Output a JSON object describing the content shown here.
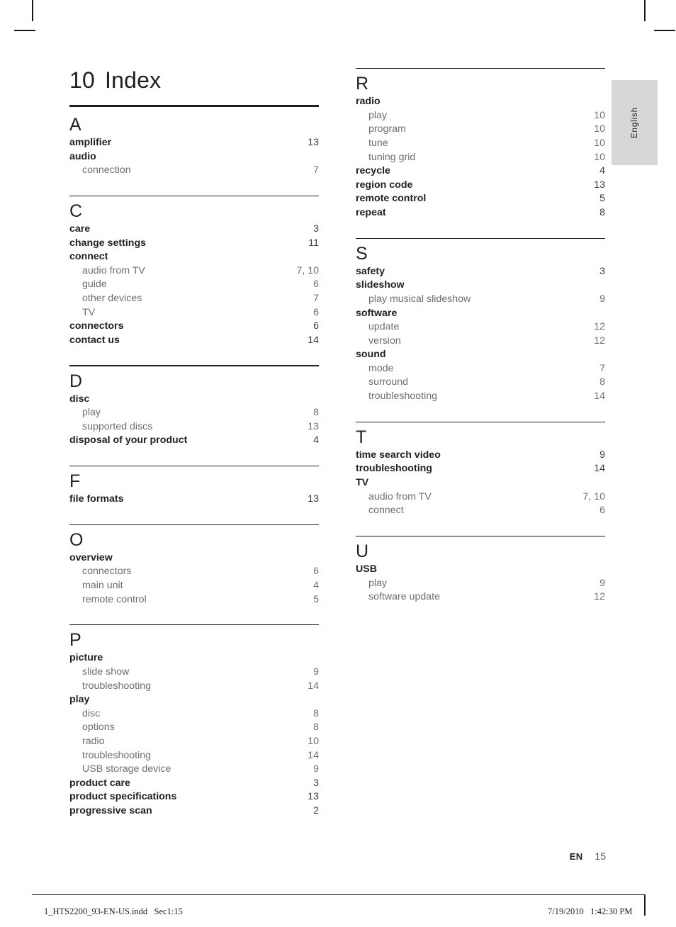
{
  "document": {
    "title_number": "10",
    "title_text": "Index",
    "language_tab": "English"
  },
  "folio": {
    "language_code": "EN",
    "page_number": "15"
  },
  "production_footer": {
    "filename": "1_HTS2200_93-EN-US.indd   Sec1:15",
    "timestamp": "7/19/2010   1:42:30 PM"
  },
  "columns": {
    "left": [
      {
        "letter": "A",
        "entries": [
          {
            "level": 1,
            "label": "amplifier",
            "pages": "13"
          },
          {
            "level": 1,
            "label": "audio",
            "pages": ""
          },
          {
            "level": 2,
            "label": "connection",
            "pages": "7"
          }
        ]
      },
      {
        "letter": "C",
        "entries": [
          {
            "level": 1,
            "label": "care",
            "pages": "3"
          },
          {
            "level": 1,
            "label": "change settings",
            "pages": "11"
          },
          {
            "level": 1,
            "label": "connect",
            "pages": ""
          },
          {
            "level": 2,
            "label": "audio from TV",
            "pages": "7, 10"
          },
          {
            "level": 2,
            "label": "guide",
            "pages": "6"
          },
          {
            "level": 2,
            "label": "other devices",
            "pages": "7"
          },
          {
            "level": 2,
            "label": "TV",
            "pages": "6"
          },
          {
            "level": 1,
            "label": "connectors",
            "pages": "6"
          },
          {
            "level": 1,
            "label": "contact us",
            "pages": "14"
          }
        ]
      },
      {
        "letter": "D",
        "entries": [
          {
            "level": 1,
            "label": "disc",
            "pages": ""
          },
          {
            "level": 2,
            "label": "play",
            "pages": "8"
          },
          {
            "level": 2,
            "label": "supported discs",
            "pages": "13"
          },
          {
            "level": 1,
            "label": "disposal of your product",
            "pages": "4"
          }
        ]
      },
      {
        "letter": "F",
        "entries": [
          {
            "level": 1,
            "label": "file formats",
            "pages": "13"
          }
        ]
      },
      {
        "letter": "O",
        "entries": [
          {
            "level": 1,
            "label": "overview",
            "pages": ""
          },
          {
            "level": 2,
            "label": "connectors",
            "pages": "6"
          },
          {
            "level": 2,
            "label": "main unit",
            "pages": "4"
          },
          {
            "level": 2,
            "label": "remote control",
            "pages": "5"
          }
        ]
      },
      {
        "letter": "P",
        "entries": [
          {
            "level": 1,
            "label": "picture",
            "pages": ""
          },
          {
            "level": 2,
            "label": "slide show",
            "pages": "9"
          },
          {
            "level": 2,
            "label": "troubleshooting",
            "pages": "14"
          },
          {
            "level": 1,
            "label": "play",
            "pages": ""
          },
          {
            "level": 2,
            "label": "disc",
            "pages": "8"
          },
          {
            "level": 2,
            "label": "options",
            "pages": "8"
          },
          {
            "level": 2,
            "label": "radio",
            "pages": "10"
          },
          {
            "level": 2,
            "label": "troubleshooting",
            "pages": "14"
          },
          {
            "level": 2,
            "label": "USB storage device",
            "pages": "9"
          },
          {
            "level": 1,
            "label": "product care",
            "pages": "3"
          },
          {
            "level": 1,
            "label": "product specifications",
            "pages": "13"
          },
          {
            "level": 1,
            "label": "progressive scan",
            "pages": "2"
          }
        ]
      }
    ],
    "right": [
      {
        "letter": "R",
        "entries": [
          {
            "level": 1,
            "label": "radio",
            "pages": ""
          },
          {
            "level": 2,
            "label": "play",
            "pages": "10"
          },
          {
            "level": 2,
            "label": "program",
            "pages": "10"
          },
          {
            "level": 2,
            "label": "tune",
            "pages": "10"
          },
          {
            "level": 2,
            "label": "tuning grid",
            "pages": "10"
          },
          {
            "level": 1,
            "label": "recycle",
            "pages": "4"
          },
          {
            "level": 1,
            "label": "region code",
            "pages": "13"
          },
          {
            "level": 1,
            "label": "remote control",
            "pages": "5"
          },
          {
            "level": 1,
            "label": "repeat",
            "pages": "8"
          }
        ]
      },
      {
        "letter": "S",
        "entries": [
          {
            "level": 1,
            "label": "safety",
            "pages": "3"
          },
          {
            "level": 1,
            "label": "slideshow",
            "pages": ""
          },
          {
            "level": 2,
            "label": "play musical slideshow",
            "pages": "9"
          },
          {
            "level": 1,
            "label": "software",
            "pages": ""
          },
          {
            "level": 2,
            "label": "update",
            "pages": "12"
          },
          {
            "level": 2,
            "label": "version",
            "pages": "12"
          },
          {
            "level": 1,
            "label": "sound",
            "pages": ""
          },
          {
            "level": 2,
            "label": "mode",
            "pages": "7"
          },
          {
            "level": 2,
            "label": "surround",
            "pages": "8"
          },
          {
            "level": 2,
            "label": "troubleshooting",
            "pages": "14"
          }
        ]
      },
      {
        "letter": "T",
        "entries": [
          {
            "level": 1,
            "label": "time search video",
            "pages": "9"
          },
          {
            "level": 1,
            "label": "troubleshooting",
            "pages": "14"
          },
          {
            "level": 1,
            "label": "TV",
            "pages": ""
          },
          {
            "level": 2,
            "label": "audio from TV",
            "pages": "7, 10"
          },
          {
            "level": 2,
            "label": "connect",
            "pages": "6"
          }
        ]
      },
      {
        "letter": "U",
        "entries": [
          {
            "level": 1,
            "label": "USB",
            "pages": ""
          },
          {
            "level": 2,
            "label": "play",
            "pages": "9"
          },
          {
            "level": 2,
            "label": "software update",
            "pages": "12"
          }
        ]
      }
    ]
  }
}
